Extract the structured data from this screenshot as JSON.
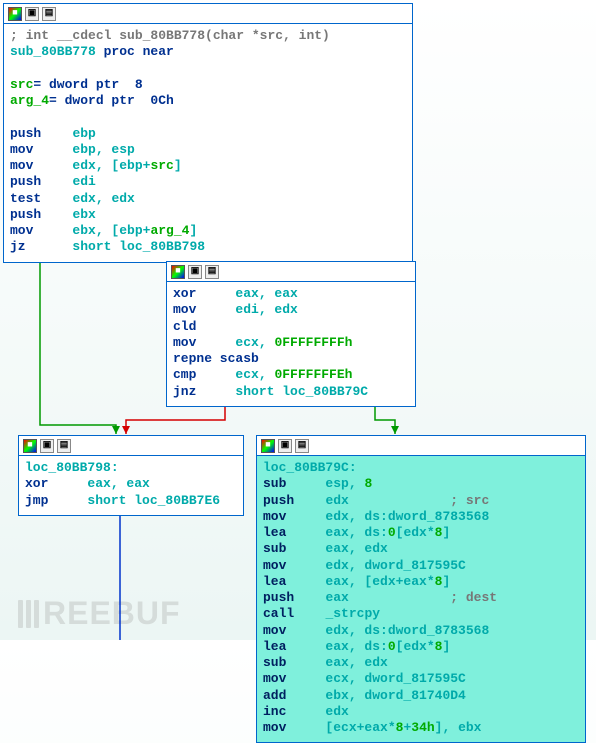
{
  "watermark": "REEBUF",
  "node1": {
    "line1_comment": "; int __cdecl sub_80BB778(char *src, int)",
    "line2_a": "sub_80BB778",
    "line2_b": " proc near",
    "arg1_name": "src",
    "arg1_rest": "= dword ptr  8",
    "arg2_name": "arg_4",
    "arg2_rest": "= dword ptr  0Ch",
    "i1_op": "push",
    "i1_a": "ebp",
    "i2_op": "mov",
    "i2_a": "ebp, esp",
    "i3_op": "mov",
    "i3_a": "edx, [ebp+",
    "i3_b": "src",
    "i3_c": "]",
    "i4_op": "push",
    "i4_a": "edi",
    "i5_op": "test",
    "i5_a": "edx, edx",
    "i6_op": "push",
    "i6_a": "ebx",
    "i7_op": "mov",
    "i7_a": "ebx, [ebp+",
    "i7_b": "arg_4",
    "i7_c": "]",
    "i8_op": "jz",
    "i8_a": "short loc_80BB798"
  },
  "node2": {
    "i1_op": "xor",
    "i1_a": "eax, eax",
    "i2_op": "mov",
    "i2_a": "edi, edx",
    "i3_op": "cld",
    "i4_op": "mov",
    "i4_a": "ecx, ",
    "i4_b": "0FFFFFFFFh",
    "i5_op": "repne scasb",
    "i6_op": "cmp",
    "i6_a": "ecx, ",
    "i6_b": "0FFFFFFFEh",
    "i7_op": "jnz",
    "i7_a": "short loc_80BB79C"
  },
  "node3": {
    "label": "loc_80BB798:",
    "i1_op": "xor",
    "i1_a": "eax, eax",
    "i2_op": "jmp",
    "i2_a": "short loc_80BB7E6"
  },
  "node4": {
    "label": "loc_80BB79C:",
    "i1_op": "sub",
    "i1_a": "esp, ",
    "i1_b": "8",
    "i2_op": "push",
    "i2_a": "edx",
    "i2_c": "; src",
    "i3_op": "mov",
    "i3_a": "edx, ds:dword_8783568",
    "i4_op": "lea",
    "i4_a": "eax, ds:",
    "i4_b": "0",
    "i4_d": "[edx*",
    "i4_e": "8",
    "i4_f": "]",
    "i5_op": "sub",
    "i5_a": "eax, edx",
    "i6_op": "mov",
    "i6_a": "edx, dword_817595C",
    "i7_op": "lea",
    "i7_a": "eax, [edx+eax*",
    "i7_b": "8",
    "i7_d": "]",
    "i8_op": "push",
    "i8_a": "eax",
    "i8_c": "; dest",
    "i9_op": "call",
    "i9_a": "_strcpy",
    "i10_op": "mov",
    "i10_a": "edx, ds:dword_8783568",
    "i11_op": "lea",
    "i11_a": "eax, ds:",
    "i11_b": "0",
    "i11_d": "[edx*",
    "i11_e": "8",
    "i11_f": "]",
    "i12_op": "sub",
    "i12_a": "eax, edx",
    "i13_op": "mov",
    "i13_a": "ecx, dword_817595C",
    "i14_op": "add",
    "i14_a": "ebx, dword_81740D4",
    "i15_op": "inc",
    "i15_a": "edx",
    "i16_op": "mov",
    "i16_a": "[ecx+eax*",
    "i16_b": "8",
    "i16_d": "+",
    "i16_e": "34h",
    "i16_f": "], ebx"
  }
}
